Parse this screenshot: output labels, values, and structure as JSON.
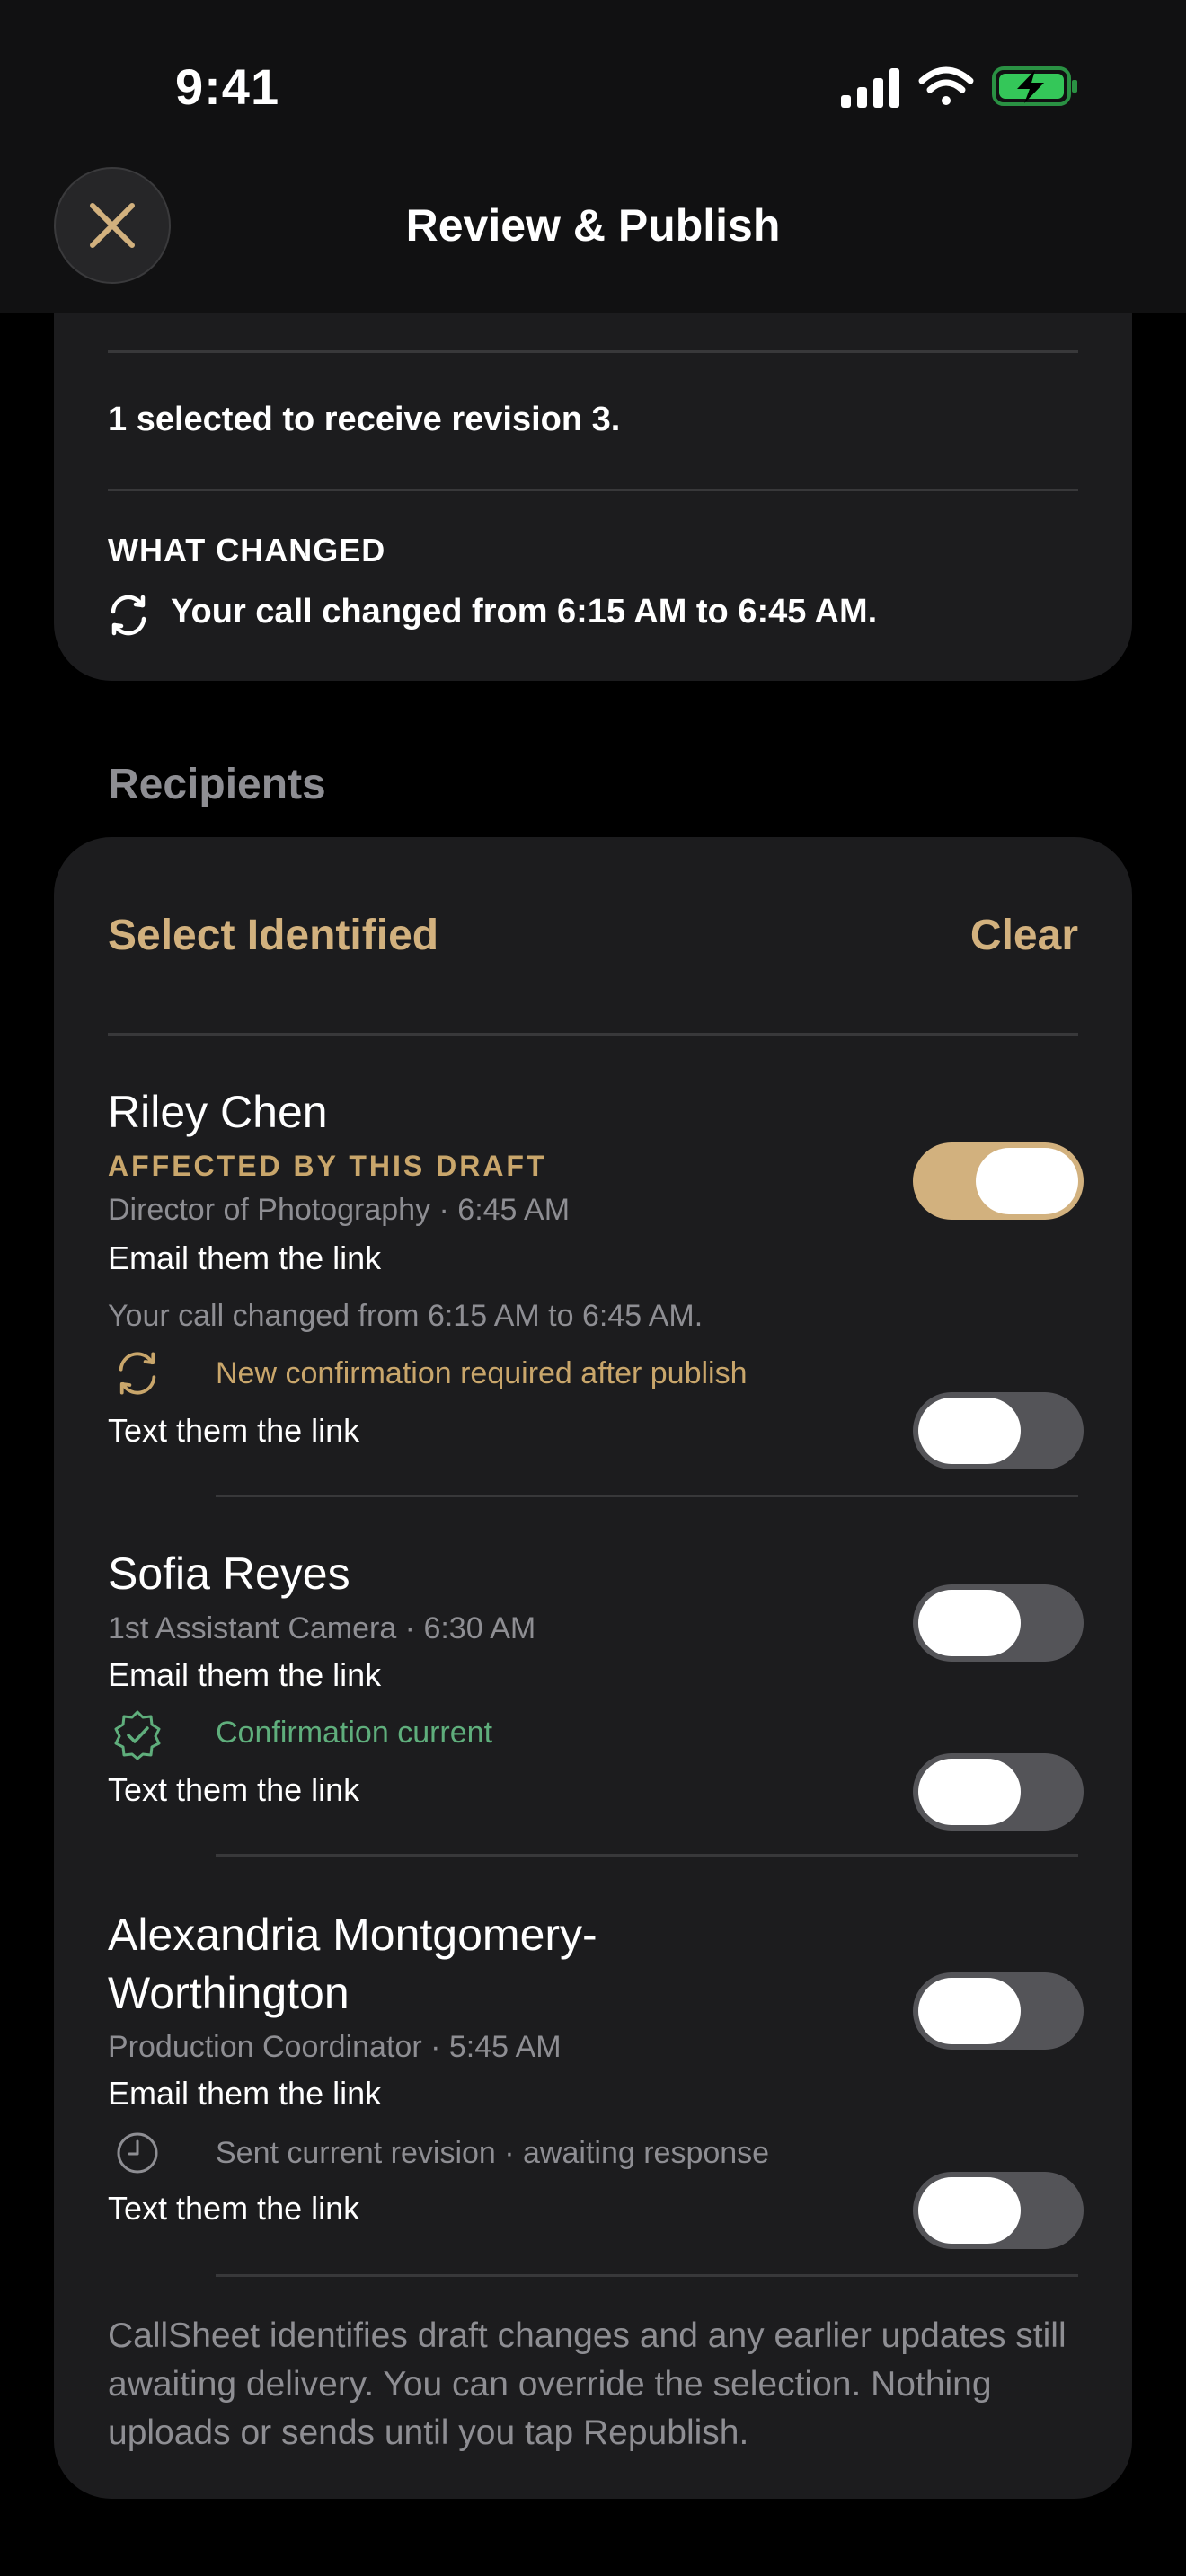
{
  "status_bar": {
    "time": "9:41",
    "icons": [
      "cellular-signal-icon",
      "wifi-icon",
      "battery-charging-icon"
    ]
  },
  "header": {
    "title": "Review & Publish",
    "close_icon": "close-icon"
  },
  "summary": {
    "selected_text": "1 selected to receive revision 3.",
    "what_changed_heading": "WHAT CHANGED",
    "change_text": "Your call changed from 6:15 AM to 6:45 AM."
  },
  "recipients": {
    "section_title": "Recipients",
    "select_identified_label": "Select Identified",
    "clear_label": "Clear",
    "people": [
      {
        "name": "Riley Chen",
        "badge": "AFFECTED BY THIS DRAFT",
        "role_time": "Director of Photography · 6:45 AM",
        "email_label": "Email them the link",
        "email_on": true,
        "change_note": "Your call changed from 6:15 AM to 6:45 AM.",
        "status_icon": "refresh-icon",
        "status_text": "New confirmation required after publish",
        "status_color": "#c9a66b",
        "text_label": "Text them the link",
        "text_on": false
      },
      {
        "name": "Sofia Reyes",
        "role_time": "1st Assistant Camera · 6:30 AM",
        "email_label": "Email them the link",
        "email_on": false,
        "status_icon": "verified-seal-icon",
        "status_text": "Confirmation current",
        "status_color": "#5fae7c",
        "text_label": "Text them the link",
        "text_on": false
      },
      {
        "name": "Alexandria Montgomery-Worthington",
        "role_time": "Production Coordinator · 5:45 AM",
        "email_label": "Email them the link",
        "email_on": false,
        "status_icon": "clock-icon",
        "status_text": "Sent current revision · awaiting response",
        "status_color": "#8e8e93",
        "text_label": "Text them the link",
        "text_on": false
      }
    ],
    "footer_note": "CallSheet identifies draft changes and any earlier updates still awaiting delivery. You can override the selection. Nothing uploads or sends until you tap Republish."
  },
  "colors": {
    "accent": "#d2b17e",
    "background": "#000000",
    "card": "#1c1c1e",
    "success": "#5fae7c"
  }
}
